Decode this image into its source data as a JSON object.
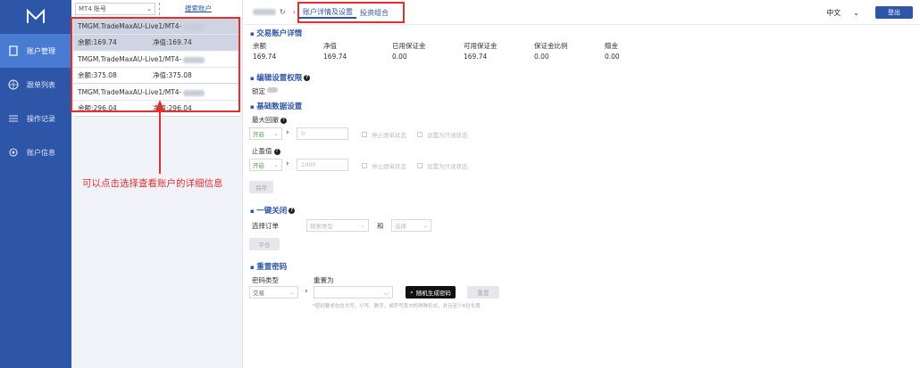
{
  "nav": {
    "items": [
      {
        "label": "账户管理",
        "icon": "document-icon"
      },
      {
        "label": "跟单列表",
        "icon": "globe-icon"
      },
      {
        "label": "操作记录",
        "icon": "list-icon"
      },
      {
        "label": "账户信息",
        "icon": "gear-icon"
      }
    ]
  },
  "accounts": {
    "selector": "MT4 账号",
    "search_link": "搜索账户",
    "balance_label": "余额",
    "equity_label": "净值",
    "list": [
      {
        "name": "TMGM.TradeMaxAU-Live1/MT4-",
        "balance": "169.74",
        "equity": "169.74"
      },
      {
        "name": "TMGM.TradeMaxAU-Live1/MT4-",
        "balance": "375.08",
        "equity": "375.08"
      },
      {
        "name": "TMGM.TradeMaxAU-Live1/MT4-",
        "balance": "296.04",
        "equity": "296.04"
      }
    ],
    "annotation": "可以点击选择查看账户的详细信息"
  },
  "topbar": {
    "tabs": [
      "账户详情及设置",
      "投资组合"
    ],
    "language": "中文",
    "logout": "登出"
  },
  "details": {
    "title": "交易账户详情",
    "fields": [
      {
        "label": "余额",
        "value": "169.74"
      },
      {
        "label": "净值",
        "value": "169.74"
      },
      {
        "label": "已用保证金",
        "value": "0.00"
      },
      {
        "label": "可用保证金",
        "value": "169.74"
      },
      {
        "label": "保证金比例",
        "value": "0.00"
      },
      {
        "label": "赠金",
        "value": "0.00"
      }
    ]
  },
  "permission": {
    "title": "编辑设置权限",
    "lock_label": "锁定"
  },
  "basic": {
    "title": "基础数据设置",
    "drawdown_label": "最大回撤",
    "drawdown_select": "开启",
    "drawdown_value": "0",
    "stop_label": "止盈值",
    "stop_select": "开启",
    "stop_value": "1000",
    "opt_stop": "停止跟单状态",
    "opt_readonly": "设置为只读状态",
    "save": "保存"
  },
  "close": {
    "title": "一键关闭",
    "order_label": "选择订单",
    "order_placeholder": "搜索类型",
    "and_label": "和",
    "choose_placeholder": "选择",
    "close_button": "平仓"
  },
  "reset": {
    "title": "重置密码",
    "type_label": "密码类型",
    "type_value": "交易",
    "reset_label": "重置为",
    "generate_button": "随机生成密码",
    "reset_button": "重置",
    "hint": "*密码要求包含大写、小写、数字、或符号其中的两种形式，并且至少6位长度"
  },
  "colors": {
    "accent": "#2d56a8",
    "highlight": "#e03030"
  }
}
